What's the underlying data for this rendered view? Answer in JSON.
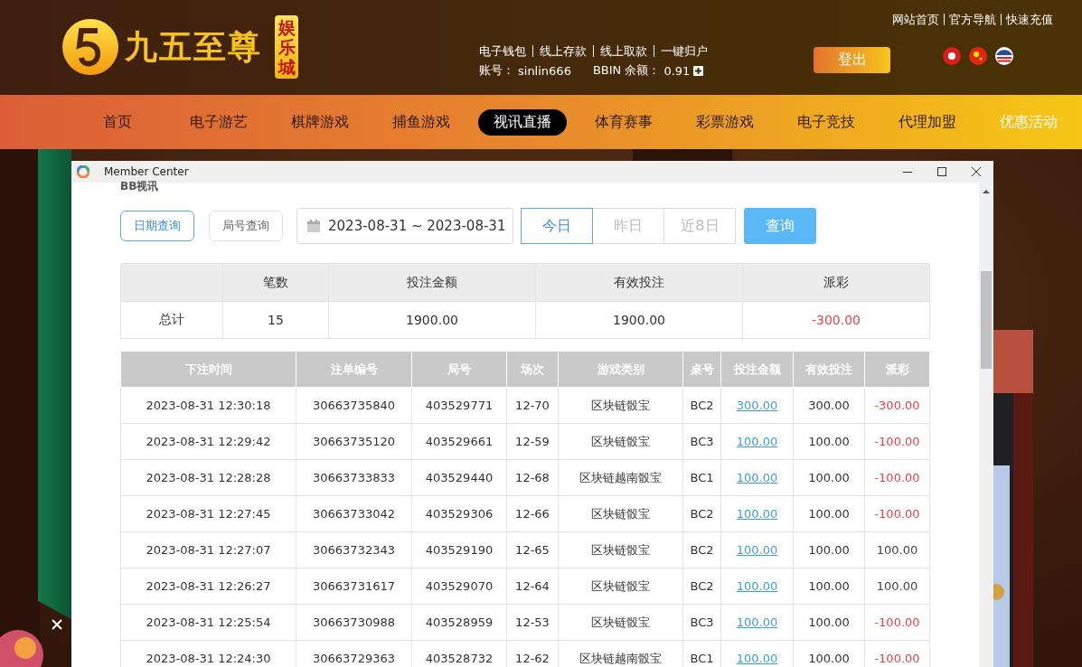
{
  "header": {
    "logo_text": "九五至尊",
    "logo_badge": "娱乐城",
    "top_links": [
      "网站首页",
      "官方导航",
      "快速充值"
    ],
    "wallet_links": [
      "电子钱包",
      "线上存款",
      "线上取款",
      "一键归户"
    ],
    "account_label": "账号：",
    "account": "sinlin666",
    "balance_label": "BBIN 余额：",
    "balance": "0.91",
    "logout": "登出"
  },
  "nav": [
    {
      "label": "首页",
      "selected": false,
      "highlight": false
    },
    {
      "label": "电子游艺",
      "selected": false,
      "highlight": false
    },
    {
      "label": "棋牌游戏",
      "selected": false,
      "highlight": false
    },
    {
      "label": "捕鱼游戏",
      "selected": false,
      "highlight": false
    },
    {
      "label": "视讯直播",
      "selected": true,
      "highlight": false
    },
    {
      "label": "体育赛事",
      "selected": false,
      "highlight": false
    },
    {
      "label": "彩票游戏",
      "selected": false,
      "highlight": false
    },
    {
      "label": "电子竞技",
      "selected": false,
      "highlight": false
    },
    {
      "label": "代理加盟",
      "selected": false,
      "highlight": false
    },
    {
      "label": "优惠活动",
      "selected": false,
      "highlight": true
    }
  ],
  "window": {
    "title": "Member Center"
  },
  "dialog": {
    "title": "BB视讯",
    "query_modes": [
      {
        "label": "日期查询",
        "selected": true
      },
      {
        "label": "局号查询",
        "selected": false
      }
    ],
    "date_range": "2023-08-31 ~ 2023-08-31",
    "quick_ranges": [
      {
        "label": "今日",
        "selected": true
      },
      {
        "label": "昨日",
        "selected": false
      },
      {
        "label": "近8日",
        "selected": false
      }
    ],
    "search_button": "查询",
    "summary": {
      "columns": [
        "",
        "笔数",
        "投注金额",
        "有效投注",
        "派彩"
      ],
      "label": "总计",
      "count": "15",
      "stake": "1900.00",
      "valid": "1900.00",
      "payout": "-300.00",
      "color": "#e8424a"
    },
    "table": {
      "columns": [
        "下注时间",
        "注单编号",
        "局号",
        "场次",
        "游戏类别",
        "桌号",
        "投注金额",
        "有效投注",
        "派彩"
      ],
      "rows": [
        {
          "time": "2023-08-31 12:30:18",
          "bet_id": "30663735840",
          "round": "403529771",
          "session": "12-70",
          "game": "区块链骰宝",
          "table": "BC2",
          "stake": "300.00",
          "valid": "300.00",
          "payout": "-300.00",
          "color": "#e8424a"
        },
        {
          "time": "2023-08-31 12:29:42",
          "bet_id": "30663735120",
          "round": "403529661",
          "session": "12-59",
          "game": "区块链骰宝",
          "table": "BC3",
          "stake": "100.00",
          "valid": "100.00",
          "payout": "-100.00",
          "color": "#e8424a"
        },
        {
          "time": "2023-08-31 12:28:28",
          "bet_id": "30663733833",
          "round": "403529440",
          "session": "12-68",
          "game": "区块链越南骰宝",
          "table": "BC1",
          "stake": "100.00",
          "valid": "100.00",
          "payout": "-100.00",
          "color": "#e8424a"
        },
        {
          "time": "2023-08-31 12:27:45",
          "bet_id": "30663733042",
          "round": "403529306",
          "session": "12-66",
          "game": "区块链骰宝",
          "table": "BC2",
          "stake": "100.00",
          "valid": "100.00",
          "payout": "-100.00",
          "color": "#e8424a"
        },
        {
          "time": "2023-08-31 12:27:07",
          "bet_id": "30663732343",
          "round": "403529190",
          "session": "12-65",
          "game": "区块链骰宝",
          "table": "BC2",
          "stake": "100.00",
          "valid": "100.00",
          "payout": "100.00",
          "color": "#444444"
        },
        {
          "time": "2023-08-31 12:26:27",
          "bet_id": "30663731617",
          "round": "403529070",
          "session": "12-64",
          "game": "区块链骰宝",
          "table": "BC2",
          "stake": "100.00",
          "valid": "100.00",
          "payout": "100.00",
          "color": "#444444"
        },
        {
          "time": "2023-08-31 12:25:54",
          "bet_id": "30663730988",
          "round": "403528959",
          "session": "12-53",
          "game": "区块链骰宝",
          "table": "BC3",
          "stake": "100.00",
          "valid": "100.00",
          "payout": "-100.00",
          "color": "#e8424a"
        },
        {
          "time": "2023-08-31 12:24:30",
          "bet_id": "30663729363",
          "round": "403528732",
          "session": "12-62",
          "game": "区块链越南骰宝",
          "table": "BC1",
          "stake": "100.00",
          "valid": "100.00",
          "payout": "-100.00",
          "color": "#e8424a"
        }
      ]
    }
  }
}
